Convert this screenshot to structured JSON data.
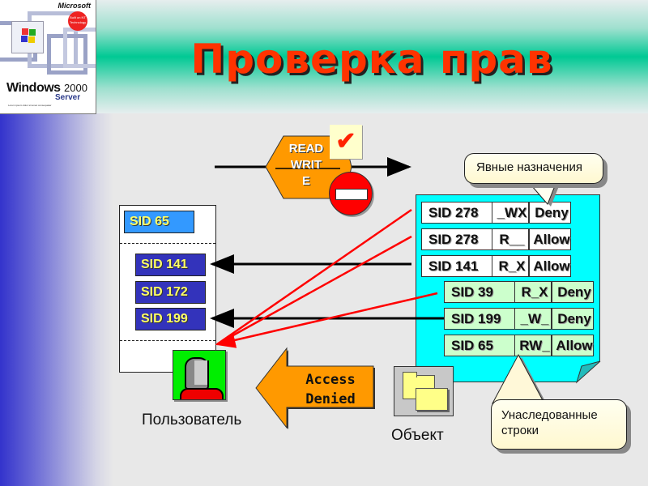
{
  "slide": {
    "title": "Проверка прав",
    "colors": {
      "title": "#ff3300",
      "accent_green": "#00c994",
      "left_band": "#3333cc",
      "object_acl_bg": "#00ffff",
      "inherited_row_bg": "#ccffcc",
      "explicit_row_bg": "#ffffff",
      "user_sid_bg": "#3333cc",
      "user_primary_sid_bg": "#3399ff",
      "arrow_orange": "#ff9900",
      "check_red": "#ff0000"
    }
  },
  "logo": {
    "brand": "Microsoft",
    "product": "Windows",
    "version": "2000",
    "edition": "Server",
    "badge": "Built on NT Technology",
    "tagline": "Lorem ipsum dolor sit amet consequater"
  },
  "request": {
    "rights": [
      "READ",
      "WRIT",
      "E"
    ],
    "granted_icon": "checkmark-icon",
    "denied_icon": "no-entry-icon"
  },
  "user_token": {
    "primary_sid": "SID 65",
    "group_sids": [
      "SID 141",
      "SID 172",
      "SID 199"
    ],
    "label": "Пользователь",
    "icon": "user-head-icon"
  },
  "result": {
    "line1": "Access",
    "line2": "Denied"
  },
  "object": {
    "label": "Объект",
    "icon": "folder-icon",
    "explicit_aces": [
      {
        "sid": "SID 278",
        "rights": "_WX",
        "type": "Deny"
      },
      {
        "sid": "SID 278",
        "rights": "R__",
        "type": "Allow"
      },
      {
        "sid": "SID 141",
        "rights": "R_X",
        "type": "Allow"
      }
    ],
    "inherited_aces": [
      {
        "sid": "SID 39",
        "rights": "R_X",
        "type": "Deny"
      },
      {
        "sid": "SID 199",
        "rights": "_W_",
        "type": "Deny"
      },
      {
        "sid": "SID 65",
        "rights": "RW_",
        "type": "Allow"
      }
    ]
  },
  "callouts": {
    "explicit": "Явные назначения",
    "inherited_line1": "Унаследованные",
    "inherited_line2": "строки"
  }
}
